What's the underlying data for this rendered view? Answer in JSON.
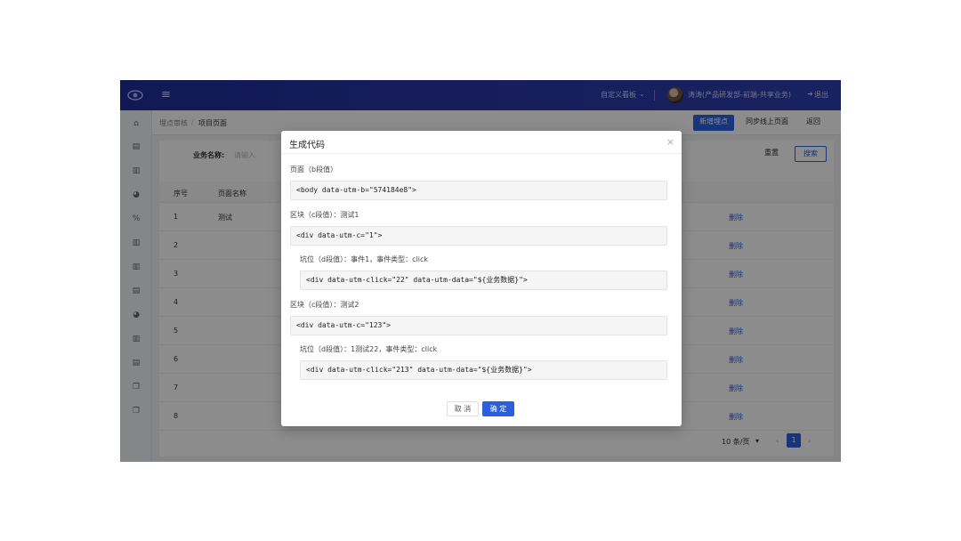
{
  "topbar": {
    "custom_report": "自定义看板",
    "user": "涛涛(产品研发部-前端-共享业务)",
    "logout": "退出"
  },
  "breadcrumb": {
    "root": "埋点审核",
    "separator": "/",
    "current": "项目页面"
  },
  "actions": {
    "add_point": "新增埋点",
    "sync_online": "同步线上页面",
    "back": "返回"
  },
  "filter": {
    "business_label": "业务名称:",
    "business_placeholder": "请输入",
    "reset": "重置",
    "search": "搜索"
  },
  "table": {
    "headers": [
      "序号",
      "页面名称"
    ],
    "rows": [
      {
        "index": "1",
        "name": "测试",
        "action": "删除"
      },
      {
        "index": "2",
        "name": "",
        "action": "删除"
      },
      {
        "index": "3",
        "name": "",
        "action": "删除"
      },
      {
        "index": "4",
        "name": "",
        "action": "删除"
      },
      {
        "index": "5",
        "name": "",
        "action": "删除"
      },
      {
        "index": "6",
        "name": "",
        "action": "删除"
      },
      {
        "index": "7",
        "name": "",
        "action": "删除"
      },
      {
        "index": "8",
        "name": "",
        "action": "删除"
      }
    ]
  },
  "pagination": {
    "page_size": "10 条/页",
    "current_page": "1",
    "prev": "‹",
    "next": "›"
  },
  "modal": {
    "title": "生成代码",
    "close": "×",
    "page_label": "页面（b段值）",
    "page_code": "<body data-utm-b=\"574184e8\">",
    "block1_label": "区块（c段值）：测试1",
    "block1_code": "<div data-utm-c=\"1\">",
    "slot1_label": "坑位（d段值）：事件1，事件类型：click",
    "slot1_code": "<div data-utm-click=\"22\" data-utm-data=\"${业务数据}\">",
    "block2_label": "区块（c段值）：测试2",
    "block2_code": "<div data-utm-c=\"123\">",
    "slot2_label": "坑位（d段值）：1测试22，事件类型：click",
    "slot2_code": "<div data-utm-click=\"213\" data-utm-data=\"${业务数据}\">",
    "cancel": "取 消",
    "confirm": "确 定"
  },
  "colors": {
    "header_bg": "#2a36a6",
    "primary": "#2c5fe0",
    "overlay": "rgba(0,0,0,0.45)"
  },
  "icons": {
    "logo": "eye-logo-icon",
    "menu": "hamburger-icon",
    "sidebar": [
      "home-icon",
      "table-icon",
      "chart-icon",
      "pie-icon",
      "percent-icon",
      "bar-chart-icon",
      "bar-chart-icon",
      "table-icon",
      "pie-icon",
      "bar-chart-icon",
      "table-icon",
      "copy-icon",
      "copy-icon"
    ]
  }
}
